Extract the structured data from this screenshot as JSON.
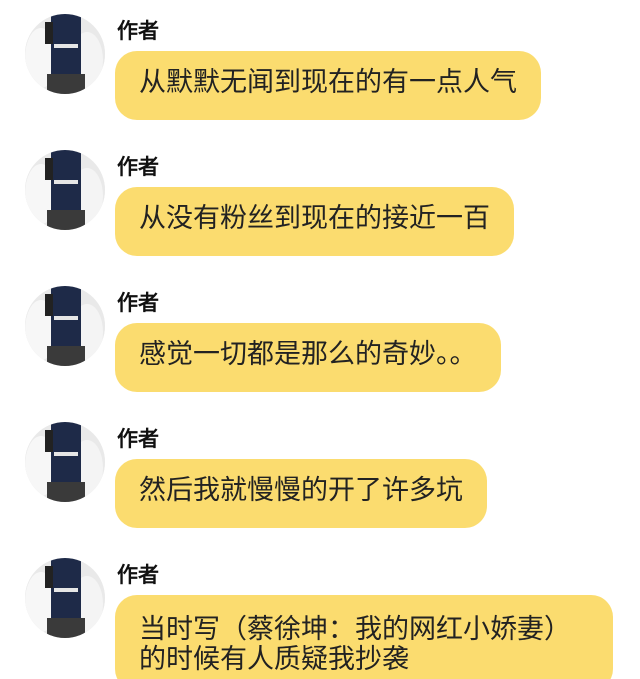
{
  "messages": [
    {
      "sender": "作者",
      "text": "从默默无闻到现在的有一点人气"
    },
    {
      "sender": "作者",
      "text": "从没有粉丝到现在的接近一百"
    },
    {
      "sender": "作者",
      "text": "感觉一切都是那么的奇妙。。"
    },
    {
      "sender": "作者",
      "text": "然后我就慢慢的开了许多坑"
    },
    {
      "sender": "作者",
      "text": "当时写（蔡徐坤：我的网红小娇妻）的时候有人质疑我抄袭"
    }
  ],
  "colors": {
    "bubble": "#fbdc6f",
    "background": "#ffffff",
    "sender_text": "#111111"
  }
}
